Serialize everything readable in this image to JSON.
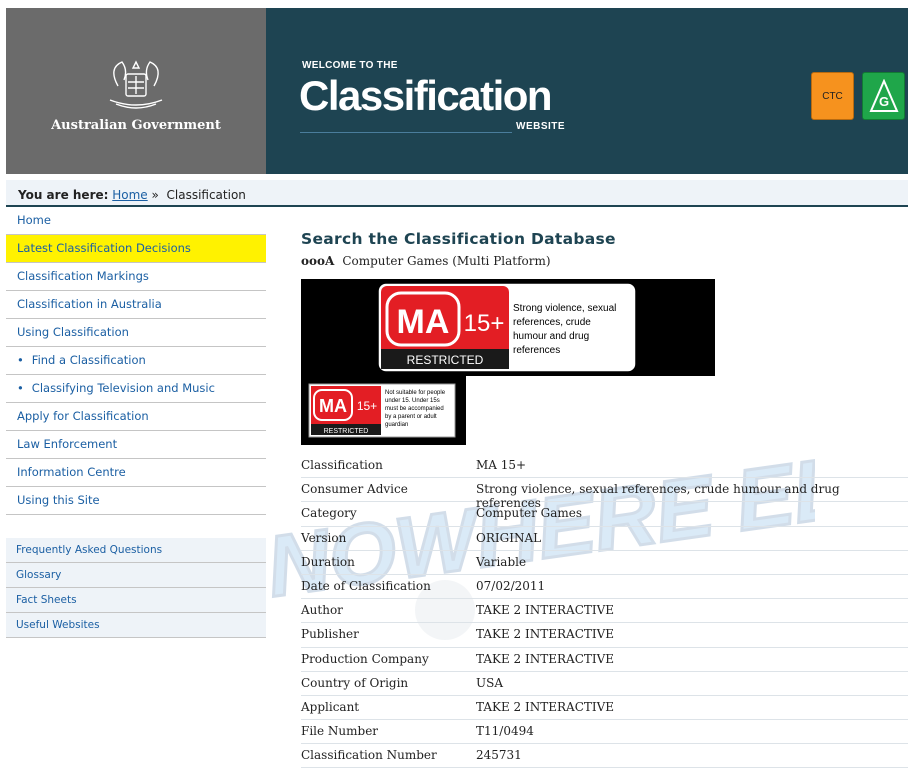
{
  "header": {
    "gov_name": "Australian Government",
    "welcome": "WELCOME TO THE",
    "title": "Classification",
    "title_suffix": "WEBSITE",
    "badges": [
      {
        "label": "CTC",
        "color": "#f6921e"
      },
      {
        "label": "G",
        "color": "#1fa64a"
      }
    ]
  },
  "breadcrumb": {
    "prefix": "You are here:",
    "home": "Home",
    "separator": "»",
    "current": "Classification"
  },
  "nav": {
    "items": [
      {
        "label": "Home",
        "bullet": false,
        "active": false
      },
      {
        "label": "Latest Classification Decisions",
        "bullet": false,
        "active": true
      },
      {
        "label": "Classification Markings",
        "bullet": false,
        "active": false
      },
      {
        "label": "Classification in Australia",
        "bullet": false,
        "active": false
      },
      {
        "label": "Using Classification",
        "bullet": false,
        "active": false
      },
      {
        "label": "Find a Classification",
        "bullet": true,
        "active": false
      },
      {
        "label": "Classifying Television and Music",
        "bullet": true,
        "active": false
      },
      {
        "label": "Apply for Classification",
        "bullet": false,
        "active": false
      },
      {
        "label": "Law Enforcement",
        "bullet": false,
        "active": false
      },
      {
        "label": "Information Centre",
        "bullet": false,
        "active": false
      },
      {
        "label": "Using this Site",
        "bullet": false,
        "active": false
      }
    ],
    "secondary": [
      "Frequently Asked Questions",
      "Glossary",
      "Fact Sheets",
      "Useful Websites"
    ]
  },
  "main": {
    "title": "Search the Classification Database",
    "item_name": "oooA",
    "item_type": "Computer Games (Multi Platform)",
    "rating_label": {
      "code": "MA",
      "age": "15+",
      "restricted": "RESTRICTED",
      "advice_lines": [
        "Strong violence, sexual",
        "references, crude",
        "humour and drug",
        "references"
      ],
      "small_advice_lines": [
        "Not suitable for people",
        "under 15. Under 15s",
        "must be accompanied",
        "by a parent or adult",
        "guardian"
      ]
    },
    "details": [
      {
        "key": "Classification",
        "value": "MA 15+"
      },
      {
        "key": "Consumer Advice",
        "value": "Strong violence, sexual references, crude humour and drug references"
      },
      {
        "key": "Category",
        "value": "Computer Games"
      },
      {
        "key": "Version",
        "value": "ORIGINAL"
      },
      {
        "key": "Duration",
        "value": "Variable"
      },
      {
        "key": "Date of Classification",
        "value": "07/02/2011"
      },
      {
        "key": "Author",
        "value": "TAKE 2 INTERACTIVE"
      },
      {
        "key": "Publisher",
        "value": "TAKE 2 INTERACTIVE"
      },
      {
        "key": "Production Company",
        "value": "TAKE 2 INTERACTIVE"
      },
      {
        "key": "Country of Origin",
        "value": "USA"
      },
      {
        "key": "Applicant",
        "value": "TAKE 2 INTERACTIVE"
      },
      {
        "key": "File Number",
        "value": "T11/0494"
      },
      {
        "key": "Classification Number",
        "value": "245731"
      }
    ]
  },
  "watermark": {
    "text": "NOWHERE ELSE"
  },
  "colors": {
    "banner": "#1e4452",
    "gov_grey": "#6b6b6b",
    "link": "#1b5fa3",
    "active_nav": "#fff200",
    "rating_red": "#e31e24"
  }
}
